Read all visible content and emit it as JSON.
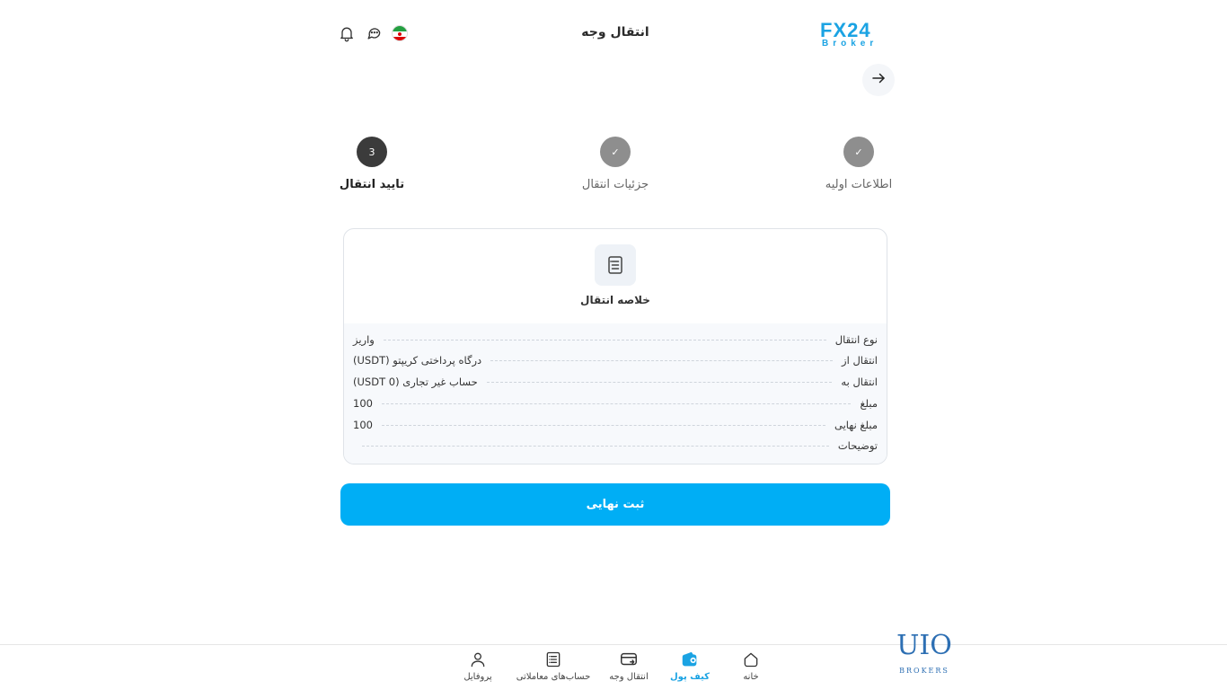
{
  "header": {
    "logo_text": "FX24",
    "logo_sub": "Broker",
    "title": "انتقال وجه"
  },
  "stepper": [
    {
      "label": "اطلاعات اولیه",
      "state": "done",
      "mark": "✓"
    },
    {
      "label": "جزئیات انتقال",
      "state": "done",
      "mark": "✓"
    },
    {
      "label": "تایید انتقال",
      "state": "active",
      "mark": "3"
    }
  ],
  "summary": {
    "title": "خلاصه انتقال",
    "rows": [
      {
        "label": "نوع انتقال",
        "value": "واریز"
      },
      {
        "label": "انتقال از",
        "value": "درگاه پرداختی کریپتو (USDT)"
      },
      {
        "label": "انتقال به",
        "value": "حساب غیر تجاری (0 USDT)"
      },
      {
        "label": "مبلغ",
        "value": "100"
      },
      {
        "label": "مبلغ نهایی",
        "value": "100"
      },
      {
        "label": "توضیحات",
        "value": ""
      }
    ]
  },
  "submit_label": "ثبت نهایی",
  "bottom_nav": [
    {
      "label": "خانه",
      "icon": "home-icon",
      "active": false
    },
    {
      "label": "کیف پول",
      "icon": "wallet-icon",
      "active": true
    },
    {
      "label": "انتقال وجه",
      "icon": "transfer-card-icon",
      "active": false
    },
    {
      "label": "حساب‌های معاملاتی",
      "icon": "accounts-list-icon",
      "active": false
    },
    {
      "label": "پروفایل",
      "icon": "profile-icon",
      "active": false
    }
  ],
  "watermark": {
    "main": "UIO",
    "sub": "BROKERS"
  },
  "colors": {
    "accent": "#00aef5",
    "step_done": "#8e8e8e",
    "step_active": "#3b3b3b"
  }
}
